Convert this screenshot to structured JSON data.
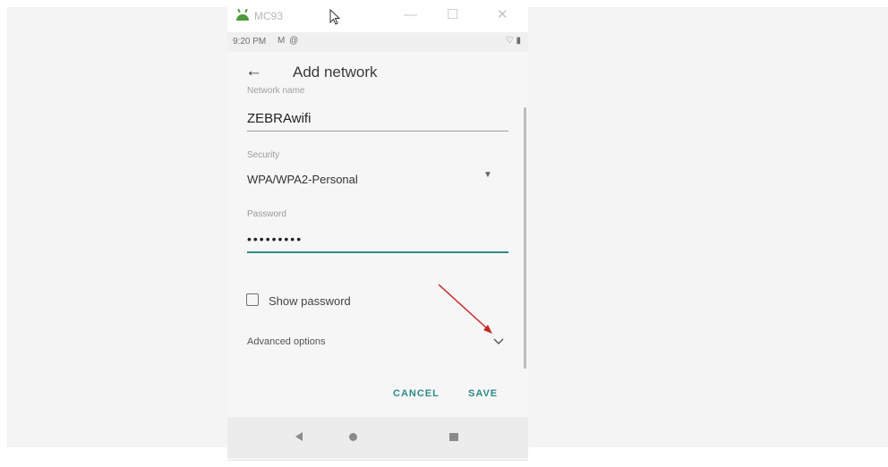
{
  "window": {
    "title": "MC93",
    "minimize_glyph": "—",
    "maximize_glyph": "☐",
    "close_glyph": "✕"
  },
  "status_bar": {
    "time": "9:20 PM",
    "notifications": "M @",
    "status_icons": "♡ ▮"
  },
  "app_bar": {
    "back_glyph": "←",
    "title": "Add network"
  },
  "form": {
    "network_name_label": "Network name",
    "network_name_value": "ZEBRAwifi",
    "security_label": "Security",
    "security_value": "WPA/WPA2-Personal",
    "password_label": "Password",
    "password_value": "•••••••••",
    "show_password_label": "Show password",
    "show_password_checked": false,
    "advanced_options_label": "Advanced options",
    "dropdown_glyph": "▼"
  },
  "actions": {
    "cancel_label": "CANCEL",
    "save_label": "SAVE"
  },
  "colors": {
    "accent": "#2e8b86",
    "annotation_arrow": "#c62828"
  }
}
